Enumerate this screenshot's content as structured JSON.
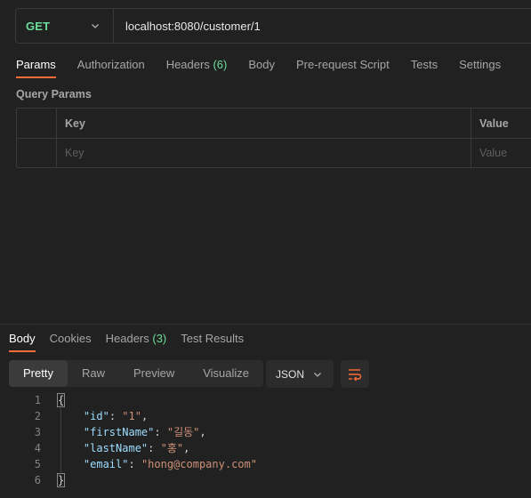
{
  "request": {
    "method": "GET",
    "url": "localhost:8080/customer/1"
  },
  "request_tabs": [
    {
      "label": "Params",
      "count": ""
    },
    {
      "label": "Authorization",
      "count": ""
    },
    {
      "label": "Headers",
      "count": "(6)"
    },
    {
      "label": "Body",
      "count": ""
    },
    {
      "label": "Pre-request Script",
      "count": ""
    },
    {
      "label": "Tests",
      "count": ""
    },
    {
      "label": "Settings",
      "count": ""
    }
  ],
  "query_params": {
    "title": "Query Params",
    "header_key": "Key",
    "header_value": "Value",
    "key_placeholder": "Key",
    "value_placeholder": "Value"
  },
  "response_tabs": [
    {
      "label": "Body",
      "count": ""
    },
    {
      "label": "Cookies",
      "count": ""
    },
    {
      "label": "Headers",
      "count": "(3)"
    },
    {
      "label": "Test Results",
      "count": ""
    }
  ],
  "view_modes": [
    "Pretty",
    "Raw",
    "Preview",
    "Visualize"
  ],
  "format": "JSON",
  "icons": {
    "method_dropdown": "chevron-down-icon",
    "format_dropdown": "chevron-down-icon",
    "wrap": "wrap-lines-icon"
  },
  "colors": {
    "accent": "#ff6c37",
    "method_get": "#6bdd9a",
    "json_key": "#9cdcfe",
    "json_string": "#ce9178"
  },
  "code": {
    "line_numbers": [
      "1",
      "2",
      "3",
      "4",
      "5",
      "6"
    ],
    "open_brace": "{",
    "close_brace": "}",
    "fields": [
      {
        "key": "\"id\"",
        "value": "\"1\"",
        "comma": ","
      },
      {
        "key": "\"firstName\"",
        "value": "\"길동\"",
        "comma": ","
      },
      {
        "key": "\"lastName\"",
        "value": "\"홍\"",
        "comma": ","
      },
      {
        "key": "\"email\"",
        "value": "\"hong@company.com\"",
        "comma": ""
      }
    ]
  }
}
